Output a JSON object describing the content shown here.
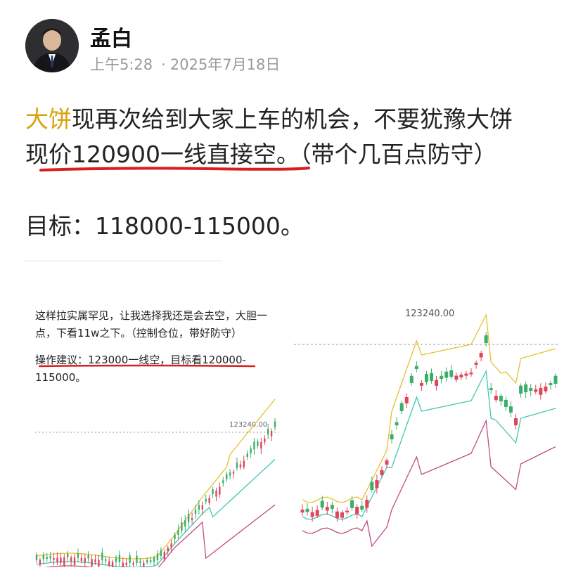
{
  "post": {
    "author": "孟白",
    "time": "上午5:28",
    "separator": "·",
    "date": "2025年7月18日",
    "highlight": "大饼",
    "line1_rest": "现再次给到大家上车的机会，不要犹豫大饼",
    "line2_underlined": "现价120900一线直接空。",
    "line2_rest": "（带个几百点防守）",
    "target": "目标：118000-115000。"
  },
  "image_left": {
    "text1": "这样拉实属罕见，让我选择我还是会去空，大胆一点，下看11w之下。（控制仓位，带好防守）",
    "text2": "操作建议：123000一线空，目标看120000-115000。",
    "price_label": "123240.00"
  },
  "image_right": {
    "price_label": "123240.00"
  },
  "colors": {
    "highlight": "#d8a10c",
    "underline": "#d81e1e",
    "up_candle": "#3cae6a",
    "down_candle": "#e0455a",
    "band_upper": "#e6c12c",
    "band_mid": "#3fc7b0",
    "band_lower": "#c04c82"
  }
}
